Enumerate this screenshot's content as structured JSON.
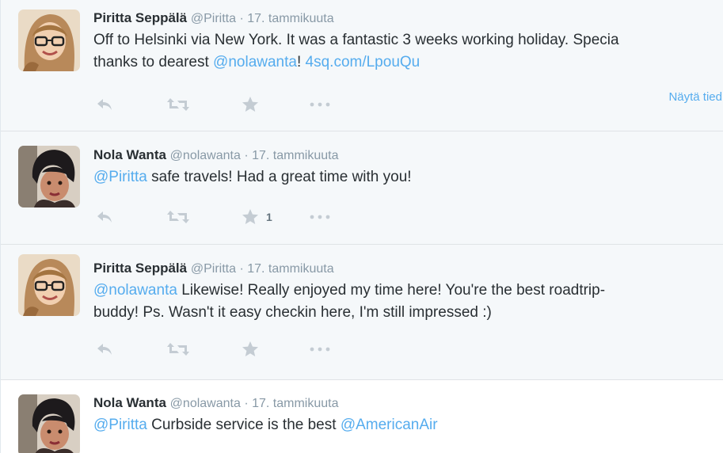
{
  "tweets": [
    {
      "name": "Piritta Seppälä",
      "handle": "@Piritta",
      "sep": "·",
      "date": "17. tammikuuta",
      "line1_text": "Off to Helsinki via New York. It was a fantastic 3 weeks working holiday. Specia",
      "line2_prefix": "thanks to dearest ",
      "line2_mention": "@nolawanta",
      "line2_mid": "! ",
      "line2_link": "4sq.com/LpouQu",
      "view_details": "Näytä tied",
      "avatar": "avatar-piritta",
      "favorites": ""
    },
    {
      "name": "Nola Wanta",
      "handle": "@nolawanta",
      "sep": "·",
      "date": "17. tammikuuta",
      "line1_mention": "@Piritta",
      "line1_text": " safe travels! Had a great time with you!",
      "avatar": "avatar-nola",
      "favorites": "1"
    },
    {
      "name": "Piritta Seppälä",
      "handle": "@Piritta",
      "sep": "·",
      "date": "17. tammikuuta",
      "line1_mention": "@nolawanta",
      "line1_text": " Likewise! Really enjoyed my time here! You're the best roadtrip-",
      "line2_text": "buddy! Ps. Wasn't it easy checkin here, I'm still impressed :)",
      "avatar": "avatar-piritta",
      "favorites": ""
    },
    {
      "name": "Nola Wanta",
      "handle": "@nolawanta",
      "sep": "·",
      "date": "17. tammikuuta",
      "line1_mention": "@Piritta",
      "line1_text": " Curbside service is the best ",
      "line1_mention2": "@AmericanAir",
      "avatar": "avatar-nola"
    }
  ],
  "icons": {
    "reply": "reply-icon",
    "retweet": "retweet-icon",
    "favorite": "star-icon",
    "more": "more-icon"
  },
  "colors": {
    "link": "#55acee",
    "shaded_bg": "#f5f8fa",
    "action_gray": "#c4ccd3"
  }
}
